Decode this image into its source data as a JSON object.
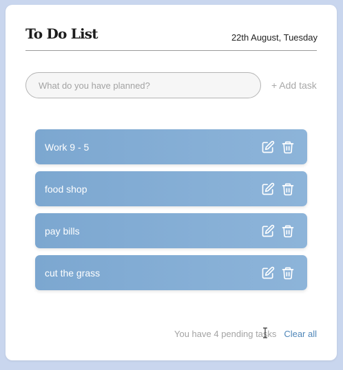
{
  "header": {
    "title": "To Do List",
    "date": "22th August, Tuesday"
  },
  "input": {
    "placeholder": "What do you have planned?",
    "value": ""
  },
  "add_button": {
    "label": "+ Add task"
  },
  "tasks": [
    {
      "label": "Work 9 - 5",
      "edit_icon": "edit-icon",
      "delete_icon": "trash-icon"
    },
    {
      "label": "food shop",
      "edit_icon": "edit-icon",
      "delete_icon": "trash-icon"
    },
    {
      "label": "pay bills",
      "edit_icon": "edit-icon",
      "delete_icon": "trash-icon"
    },
    {
      "label": "cut the grass",
      "edit_icon": "edit-icon",
      "delete_icon": "trash-icon"
    }
  ],
  "footer": {
    "pending_text": "You have 4 pending tasks",
    "clear_label": "Clear all"
  },
  "colors": {
    "page_background": "#c9d6ee",
    "card_background": "#ffffff",
    "task_background": "#7ca7d0",
    "accent_link": "#4f86b8"
  }
}
